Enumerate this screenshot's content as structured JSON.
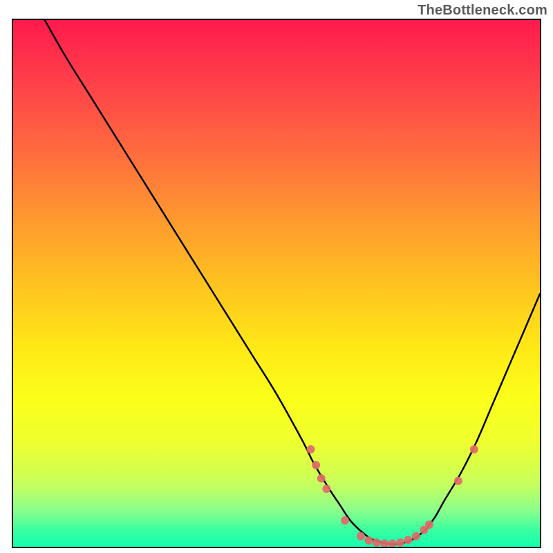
{
  "watermark": "TheBottleneck.com",
  "chart_data": {
    "type": "line",
    "title": "",
    "xlabel": "",
    "ylabel": "",
    "xlim": [
      0,
      100
    ],
    "ylim": [
      0,
      100
    ],
    "grid": false,
    "legend": false,
    "annotations": [],
    "series": [
      {
        "name": "curve",
        "color": "#000000",
        "x": [
          6,
          10,
          15,
          20,
          25,
          30,
          35,
          40,
          45,
          50,
          55,
          57,
          60,
          62,
          64,
          66,
          68,
          70,
          72,
          74,
          76,
          78,
          80,
          82,
          85,
          88,
          91,
          94,
          97,
          100
        ],
        "y": [
          100,
          93,
          85,
          77,
          69,
          61,
          53,
          45,
          37,
          29,
          20,
          16,
          11,
          8,
          5,
          3,
          1.5,
          0.8,
          0.5,
          0.7,
          1.5,
          3,
          5.5,
          9,
          14,
          20,
          27,
          34,
          41,
          48
        ]
      }
    ],
    "scatter": {
      "name": "markers",
      "color": "#e16a6a",
      "radius": 6,
      "points": [
        {
          "x": 56.5,
          "y": 18.5
        },
        {
          "x": 57.5,
          "y": 15.5
        },
        {
          "x": 58.5,
          "y": 13.0
        },
        {
          "x": 59.5,
          "y": 11.0
        },
        {
          "x": 63.0,
          "y": 5.0
        },
        {
          "x": 66.0,
          "y": 2.0
        },
        {
          "x": 67.5,
          "y": 1.2
        },
        {
          "x": 69.0,
          "y": 0.8
        },
        {
          "x": 70.5,
          "y": 0.6
        },
        {
          "x": 72.0,
          "y": 0.6
        },
        {
          "x": 73.5,
          "y": 0.8
        },
        {
          "x": 75.0,
          "y": 1.3
        },
        {
          "x": 76.5,
          "y": 2.0
        },
        {
          "x": 78.0,
          "y": 3.2
        },
        {
          "x": 79.0,
          "y": 4.2
        },
        {
          "x": 84.5,
          "y": 12.5
        },
        {
          "x": 87.5,
          "y": 18.5
        }
      ]
    },
    "gradient_stops": [
      {
        "pos": 0.0,
        "color": "#ff1a4d"
      },
      {
        "pos": 0.5,
        "color": "#ffe020"
      },
      {
        "pos": 0.8,
        "color": "#f2ff28"
      },
      {
        "pos": 1.0,
        "color": "#15ffb1"
      }
    ]
  }
}
